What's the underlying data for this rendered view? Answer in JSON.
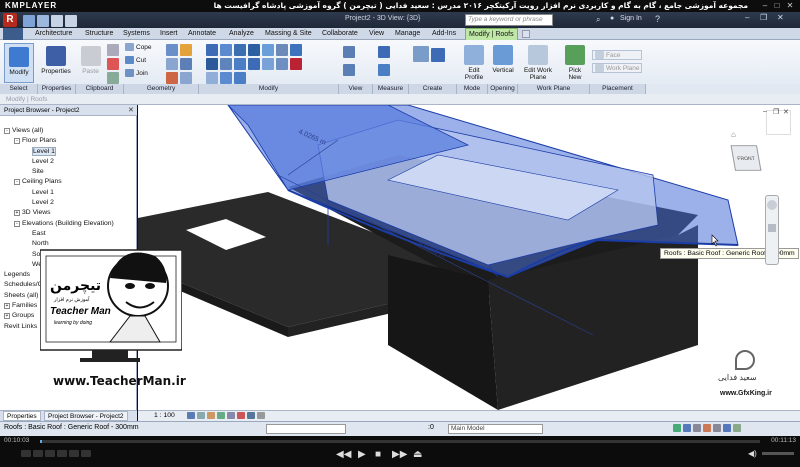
{
  "player": {
    "logo": "KMPLAYER",
    "title": "مجموعه آموزشی جامع ، گام به گام و کاربردی نرم افزار رویت آرکیتکچر ۲۰۱۶ مدرس : سعید فدایی ( تیچرمن ) گروه آموزشی پادشاه گرافیست ها",
    "time_elapsed": "00:10:03",
    "time_total": "00:11:13"
  },
  "revit": {
    "doc_title": "Project2 - 3D View: {3D}",
    "search_placeholder": "Type a keyword or phrase",
    "sign_in": "Sign In",
    "tabs": [
      "Architecture",
      "Structure",
      "Systems",
      "Insert",
      "Annotate",
      "Analyze",
      "Massing & Site",
      "Collaborate",
      "View",
      "Manage",
      "Add-Ins"
    ],
    "context_tab": "Modify | Roofs",
    "ribbon": {
      "modify": "Modify",
      "paste": "Paste",
      "properties": "Properties",
      "cope": "Cope",
      "cut": "Cut",
      "join": "Join",
      "edit_profile": "Edit Profile",
      "vertical": "Vertical",
      "edit_work_plane": "Edit Work Plane",
      "pick_new": "Pick New",
      "face": "Face",
      "work_plane": "Work Plane",
      "panels": [
        "Select",
        "Properties",
        "Clipboard",
        "Geometry",
        "Modify",
        "View",
        "Measure",
        "Create",
        "Mode",
        "Opening",
        "Work Plane",
        "Placement"
      ]
    },
    "options_bar": "Modify | Roofs",
    "project_browser": {
      "title": "Project Browser - Project2",
      "tree": [
        {
          "label": "Views (all)",
          "depth": 0,
          "toggle": "-"
        },
        {
          "label": "Floor Plans",
          "depth": 1,
          "toggle": "-"
        },
        {
          "label": "Level 1",
          "depth": 2,
          "toggle": ""
        },
        {
          "label": "Level 2",
          "depth": 2,
          "toggle": ""
        },
        {
          "label": "Site",
          "depth": 2,
          "toggle": ""
        },
        {
          "label": "Ceiling Plans",
          "depth": 1,
          "toggle": "-"
        },
        {
          "label": "Level 1",
          "depth": 2,
          "toggle": ""
        },
        {
          "label": "Level 2",
          "depth": 2,
          "toggle": ""
        },
        {
          "label": "3D Views",
          "depth": 1,
          "toggle": "+"
        },
        {
          "label": "Elevations (Building Elevation)",
          "depth": 1,
          "toggle": "-"
        },
        {
          "label": "East",
          "depth": 2,
          "toggle": ""
        },
        {
          "label": "North",
          "depth": 2,
          "toggle": ""
        },
        {
          "label": "South",
          "depth": 2,
          "toggle": ""
        },
        {
          "label": "West",
          "depth": 2,
          "toggle": ""
        },
        {
          "label": "Legends",
          "depth": 0,
          "toggle": ""
        },
        {
          "label": "Schedules/Quantities",
          "depth": 0,
          "toggle": ""
        },
        {
          "label": "Sheets (all)",
          "depth": 0,
          "toggle": ""
        },
        {
          "label": "Families",
          "depth": 0,
          "toggle": "+"
        },
        {
          "label": "Groups",
          "depth": 0,
          "toggle": "+"
        },
        {
          "label": "Revit Links",
          "depth": 0,
          "toggle": ""
        }
      ],
      "tab_properties": "Properties",
      "tab_browser": "Project Browser - Project2"
    },
    "viewport": {
      "dim_label_1": "4.0265 m",
      "dim_label_2": "4.0265 m",
      "tooltip": "Roofs : Basic Roof : Generic Roof - 300mm",
      "viewcube_face": "FRONT"
    },
    "view_scale": "1 : 100",
    "status_text": "Roofs : Basic Roof : Generic Roof - 300mm",
    "model_select": "Main Model",
    "status_num": ":0"
  },
  "watermark": {
    "brand_fa": "تیچرمن",
    "brand_sub": "آموزش نرم افزار",
    "brand_en": "Teacher Man",
    "tagline": "learning by doing",
    "url": "www.TeacherMan.ir",
    "gfx_name": "سعید فدایی",
    "gfx_url": "www.GfxKing.ir"
  },
  "colors": {
    "roof_blue": "#4a6fd8",
    "context_green": "#bfe7a6",
    "revit_red": "#b52a1c"
  }
}
